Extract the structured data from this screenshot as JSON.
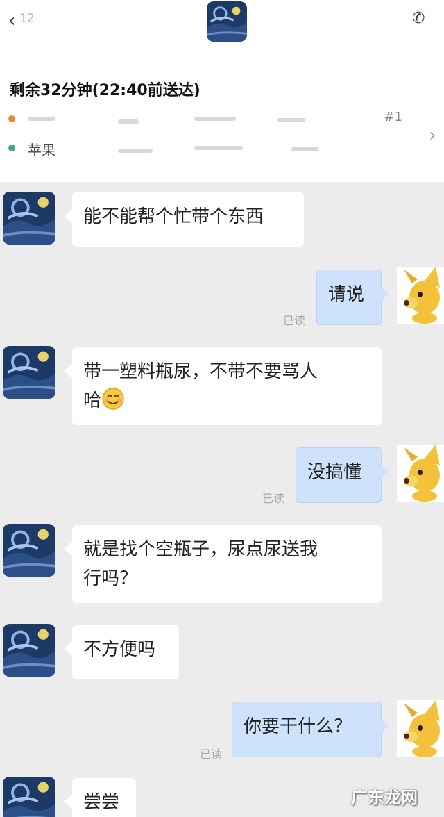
{
  "header": {
    "back_count": "12",
    "delivery_status": "剩余32分钟(22:40前送达)",
    "pickup_address_tail": "#1",
    "delivery_address": "苹果"
  },
  "messages": [
    {
      "side": "in",
      "text": "能不能帮个忙带个东西"
    },
    {
      "side": "out",
      "text": "请说",
      "read": "已读"
    },
    {
      "side": "in",
      "text_line1": "带一塑料瓶尿，不带不要骂人",
      "text_line2": "哈",
      "emoji": "smiling-face-icon"
    },
    {
      "side": "out",
      "text": "没搞懂",
      "read": "已读"
    },
    {
      "side": "in",
      "text_line1": "就是找个空瓶子，尿点尿送我",
      "text_line2": "行吗？"
    },
    {
      "side": "in",
      "text": "不方便吗"
    },
    {
      "side": "out",
      "text": "你要干什么？",
      "read": "已读"
    },
    {
      "side": "in",
      "text": "尝尝"
    }
  ],
  "watermark": "广东龙网",
  "colors": {
    "incoming_bubble": "#ffffff",
    "outgoing_bubble": "#cfe2fb",
    "background": "#ececec",
    "status_dot_pickup": "#e98a3b",
    "status_dot_delivery": "#3fae72"
  }
}
